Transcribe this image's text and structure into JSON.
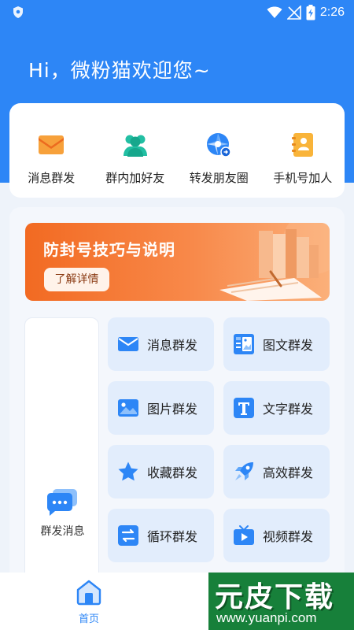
{
  "status_bar": {
    "time": "2:26"
  },
  "header": {
    "greeting": "Hi，微粉猫欢迎您~"
  },
  "quick_actions": [
    {
      "label": "消息群发",
      "icon": "envelope-icon"
    },
    {
      "label": "群内加好友",
      "icon": "users-icon"
    },
    {
      "label": "转发朋友圈",
      "icon": "moments-icon"
    },
    {
      "label": "手机号加人",
      "icon": "contacts-book-icon"
    }
  ],
  "banner": {
    "title": "防封号技巧与说明",
    "button": "了解详情"
  },
  "side_panel": {
    "label": "群发消息",
    "icon": "chat-bubbles-icon"
  },
  "features": [
    {
      "label": "消息群发",
      "icon": "envelope-icon"
    },
    {
      "label": "图文群发",
      "icon": "image-text-icon"
    },
    {
      "label": "图片群发",
      "icon": "image-icon"
    },
    {
      "label": "文字群发",
      "icon": "text-t-icon"
    },
    {
      "label": "收藏群发",
      "icon": "star-icon"
    },
    {
      "label": "高效群发",
      "icon": "rocket-icon"
    },
    {
      "label": "循环群发",
      "icon": "loop-arrows-icon"
    },
    {
      "label": "视频群发",
      "icon": "tv-play-icon"
    }
  ],
  "bottom_nav": {
    "home": "首页"
  },
  "watermark": {
    "brand": "元皮下载",
    "url": "www.yuanpi.com"
  },
  "colors": {
    "primary": "#2d86f6",
    "banner_orange": "#f26a22",
    "feature_bg": "#e2edfc"
  }
}
